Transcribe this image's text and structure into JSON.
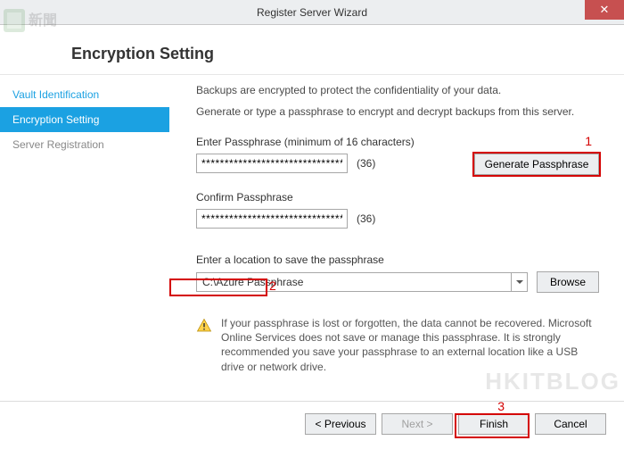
{
  "window": {
    "title": "Register Server Wizard",
    "close_glyph": "✕"
  },
  "header": {
    "title": "Encryption Setting"
  },
  "nav": {
    "items": [
      {
        "label": "Vault Identification",
        "state": "done"
      },
      {
        "label": "Encryption Setting",
        "state": "active"
      },
      {
        "label": "Server Registration",
        "state": "pending"
      }
    ]
  },
  "content": {
    "desc1": "Backups are encrypted to protect the confidentiality of your data.",
    "desc2": "Generate or type a passphrase to encrypt and decrypt backups from this server.",
    "enter_label": "Enter Passphrase (minimum of 16 characters)",
    "enter_value": "************************************",
    "enter_count": "(36)",
    "confirm_label": "Confirm Passphrase",
    "confirm_value": "************************************",
    "confirm_count": "(36)",
    "generate_label": "Generate Passphrase",
    "location_label": "Enter a location to save the passphrase",
    "location_value": "C:\\Azure Passphrase",
    "browse_label": "Browse",
    "warning_text": "If your passphrase is lost or forgotten, the data cannot be recovered. Microsoft Online Services does not save or manage this passphrase. It is strongly recommended you save your passphrase to an external location like a USB drive or network drive."
  },
  "footer": {
    "previous": "< Previous",
    "next": "Next >",
    "finish": "Finish",
    "cancel": "Cancel"
  },
  "annotations": {
    "n1": "1",
    "n2": "2",
    "n3": "3"
  },
  "watermark": {
    "text": "HKITBLOG"
  }
}
